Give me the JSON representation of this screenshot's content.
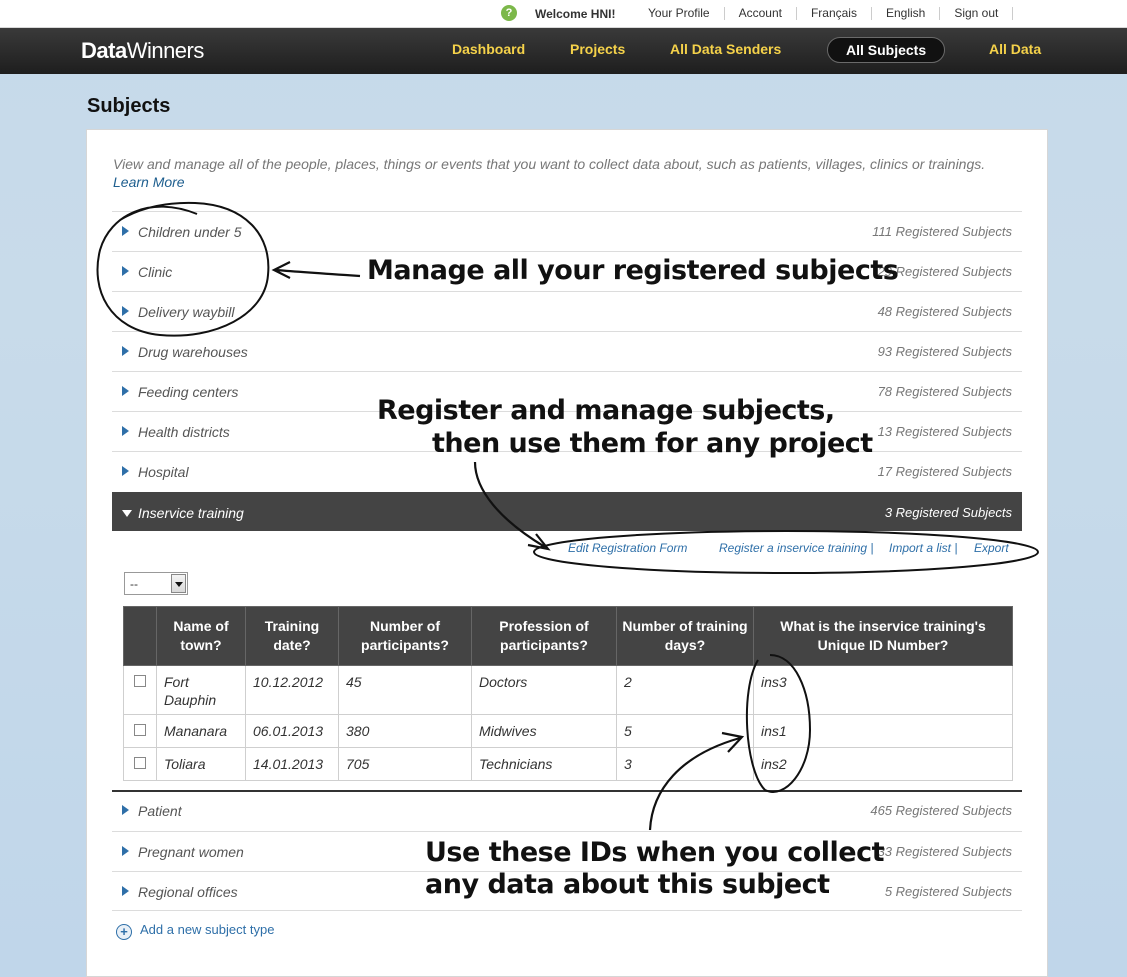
{
  "topbar": {
    "help_icon": "?",
    "welcome": "Welcome HNI!",
    "links": [
      "Your Profile",
      "Account",
      "Français",
      "English",
      "Sign out"
    ]
  },
  "navbar": {
    "logo_bold": "Data",
    "logo_light": "Winners",
    "items": [
      "Dashboard",
      "Projects",
      "All Data Senders",
      "All Subjects",
      "All Data"
    ],
    "active": "All Subjects"
  },
  "page": {
    "title": "Subjects",
    "intro": "View and manage all of the people, places, things or events that you want to collect data about, such as patients, villages, clinics or trainings.",
    "learn_more": "Learn More"
  },
  "subject_types": [
    {
      "name": "Children under 5",
      "count": "111 Registered Subjects"
    },
    {
      "name": "Clinic",
      "count": "29 Registered Subjects"
    },
    {
      "name": "Delivery waybill",
      "count": "48 Registered Subjects"
    },
    {
      "name": "Drug warehouses",
      "count": "93 Registered Subjects"
    },
    {
      "name": "Feeding centers",
      "count": "78 Registered Subjects"
    },
    {
      "name": "Health districts",
      "count": "13 Registered Subjects"
    },
    {
      "name": "Hospital",
      "count": "17 Registered Subjects"
    },
    {
      "name": "Inservice training",
      "count": "3 Registered Subjects"
    },
    {
      "name": "Patient",
      "count": "465 Registered Subjects"
    },
    {
      "name": "Pregnant women",
      "count": "33 Registered Subjects"
    },
    {
      "name": "Regional offices",
      "count": "5 Registered Subjects"
    }
  ],
  "expanded": {
    "actions": {
      "edit": "Edit Registration Form",
      "register": "Register a inservice training |",
      "import": "Import a list |",
      "export": "Export"
    },
    "select_value": "--",
    "columns": [
      "Name of town?",
      "Training date?",
      "Number of participants?",
      "Profession of participants?",
      "Number of training days?",
      "What is the inservice training's Unique ID Number?"
    ],
    "rows": [
      [
        "Fort Dauphin",
        "10.12.2012",
        "45",
        "Doctors",
        "2",
        "ins3"
      ],
      [
        "Mananara",
        "06.01.2013",
        "380",
        "Midwives",
        "5",
        "ins1"
      ],
      [
        "Toliara",
        "14.01.2013",
        "705",
        "Technicians",
        "3",
        "ins2"
      ]
    ]
  },
  "add_subject_type": "Add a new subject type",
  "annotations": {
    "manage": "Manage all your registered subjects",
    "register_1": "Register and manage subjects,",
    "register_2": "then use them for any project",
    "ids_1": "Use these IDs when you collect",
    "ids_2": "any data about this subject"
  },
  "colors": {
    "nav_link": "#f5d24a",
    "link": "#2e6fa8",
    "header_dark": "#444444"
  }
}
